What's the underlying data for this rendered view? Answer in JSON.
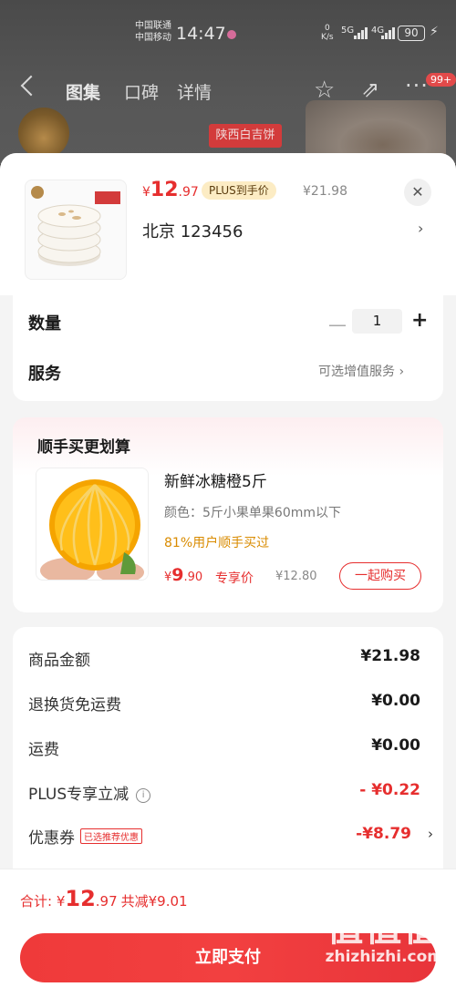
{
  "status_bar": {
    "carrier_1": "中国联通",
    "carrier_2": "中国移动",
    "time": "14:47",
    "net_speed_value": "0",
    "net_speed_unit": "K/s",
    "signal_1": "5G",
    "signal_2": "4G",
    "battery": "90"
  },
  "background_page": {
    "tabs": [
      "图集",
      "口碑",
      "详情"
    ],
    "more_badge": "99+",
    "chip_label": "陕西白吉饼"
  },
  "sheet": {
    "product": {
      "price_yen": "¥",
      "price_int": "12",
      "price_dec": ".97",
      "plus_badge": "PLUS到手价",
      "original_price": "¥21.98",
      "address": "北京  123456"
    },
    "quantity": {
      "label": "数量",
      "value": "1"
    },
    "service": {
      "label": "服务",
      "value": "可选增值服务"
    },
    "recommend": {
      "title": "顺手买更划算",
      "name": "新鲜冰糖橙5斤",
      "spec": "颜色：5斤小果单果60mm以下",
      "buyers": "81%用户顺手买过",
      "price_yen": "¥",
      "price_int": "9",
      "price_dec": ".90",
      "exclusive": "专享价",
      "original_price": "¥12.80",
      "button": "一起购买"
    },
    "summary": {
      "rows": [
        {
          "label": "商品金额",
          "value": "¥21.98"
        },
        {
          "label": "退换货免运费",
          "value": "¥0.00"
        },
        {
          "label": "运费",
          "value": "¥0.00"
        },
        {
          "label": "PLUS专享立减",
          "value": "- ¥0.22"
        },
        {
          "label": "优惠券",
          "value": "-¥8.79",
          "tag": "已选推荐优惠"
        }
      ]
    },
    "footer": {
      "total_label": "合计: ",
      "total_yen": "¥",
      "total_int": "12",
      "total_dec": ".97",
      "saved": "共减¥9.01",
      "pay_button": "立即支付"
    }
  },
  "watermark": {
    "mark": "值值值",
    "site": "zhizhizhi.com"
  },
  "colors": {
    "accent_red": "#e62e2e",
    "plus_gold": "#fcecc4",
    "buyers_orange": "#d98b00"
  }
}
